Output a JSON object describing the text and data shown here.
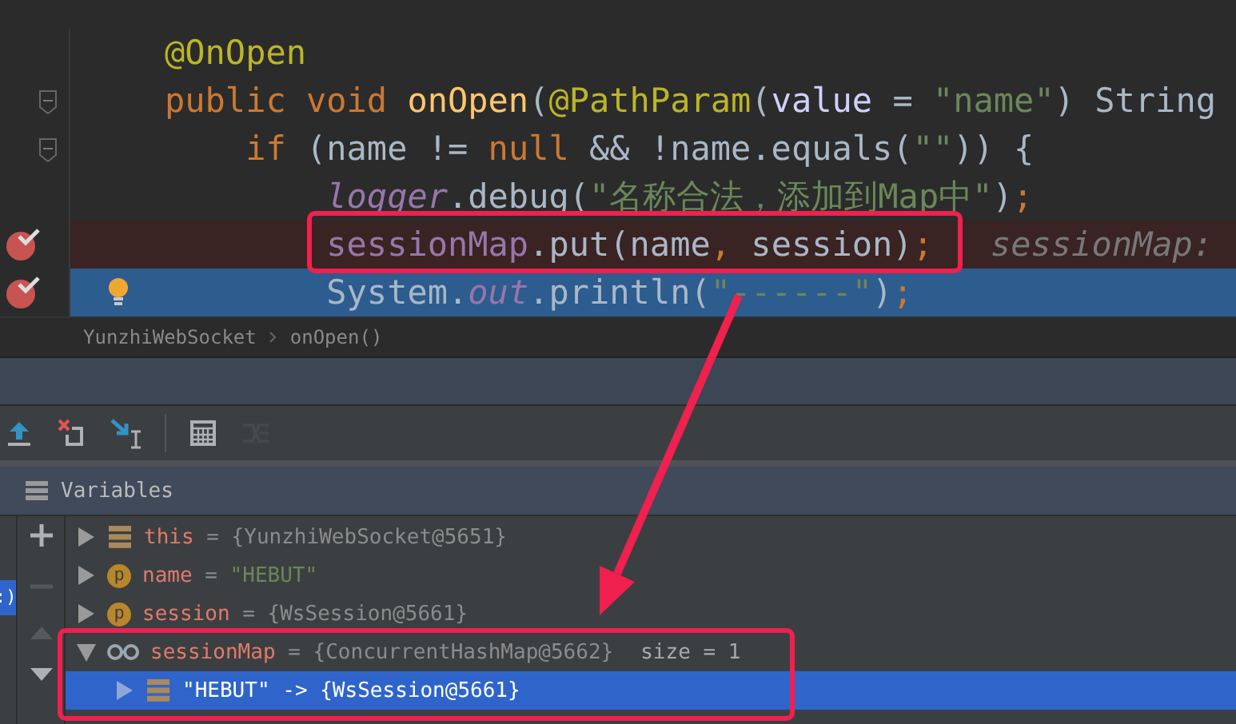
{
  "editor": {
    "lines": [
      {
        "breakpoint": false,
        "current": false,
        "fold": false,
        "hint": false,
        "tokens": [
          {
            "text": "@OnOpen",
            "kind": "annotation"
          }
        ]
      },
      {
        "breakpoint": false,
        "current": false,
        "fold": true,
        "hint": false,
        "tokens": [
          {
            "text": "public void ",
            "kind": "keyword"
          },
          {
            "text": "onOpen",
            "kind": "method"
          },
          {
            "text": "(",
            "kind": "plain"
          },
          {
            "text": "@PathParam",
            "kind": "annotation"
          },
          {
            "text": "(",
            "kind": "plain"
          },
          {
            "text": "value",
            "kind": "param"
          },
          {
            "text": " = ",
            "kind": "plain"
          },
          {
            "text": "\"name\"",
            "kind": "string"
          },
          {
            "text": ") String",
            "kind": "plain"
          }
        ],
        "children": [
          {
            "breakpoint": false,
            "current": false,
            "fold": true,
            "hint": false,
            "tokens": [
              {
                "text": "if ",
                "kind": "keyword"
              },
              {
                "text": "(name != ",
                "kind": "plain"
              },
              {
                "text": "null",
                "kind": "keyword"
              },
              {
                "text": " && !name.equals(",
                "kind": "plain"
              },
              {
                "text": "\"\"",
                "kind": "string"
              },
              {
                "text": ")) {",
                "kind": "plain"
              }
            ],
            "children": [
              {
                "breakpoint": false,
                "current": false,
                "fold": false,
                "hint": false,
                "tokens": [
                  {
                    "text": "logger",
                    "kind": "static"
                  },
                  {
                    "text": ".debug(",
                    "kind": "plain"
                  },
                  {
                    "text": "\"名称合法，添加到Map中\"",
                    "kind": "string"
                  },
                  {
                    "text": ")",
                    "kind": "plain"
                  },
                  {
                    "text": ";",
                    "kind": "punct"
                  }
                ]
              },
              {
                "breakpoint": true,
                "current": false,
                "fold": false,
                "hint": false,
                "tokens": [
                  {
                    "text": "sessionMap",
                    "kind": "field"
                  },
                  {
                    "text": ".put(name",
                    "kind": "plain"
                  },
                  {
                    "text": ",",
                    "kind": "punct"
                  },
                  {
                    "text": " session)",
                    "kind": "plain"
                  },
                  {
                    "text": ";",
                    "kind": "punct"
                  },
                  {
                    "text": "sessionMap:",
                    "kind": "inline-value"
                  }
                ]
              },
              {
                "breakpoint": true,
                "current": true,
                "fold": false,
                "hint": true,
                "tokens": [
                  {
                    "text": "System.",
                    "kind": "plain"
                  },
                  {
                    "text": "out",
                    "kind": "static"
                  },
                  {
                    "text": ".println(",
                    "kind": "plain"
                  },
                  {
                    "text": "\"------\"",
                    "kind": "string"
                  },
                  {
                    "text": ")",
                    "kind": "plain"
                  },
                  {
                    "text": ";",
                    "kind": "punct"
                  }
                ]
              }
            ]
          }
        ]
      }
    ]
  },
  "breadcrumbs": [
    "YunzhiWebSocket",
    "onOpen()"
  ],
  "toolbar": [
    {
      "kind": "step-out",
      "disabled": false
    },
    {
      "kind": "drop-frame",
      "disabled": false
    },
    {
      "kind": "run-to-cursor",
      "disabled": false
    },
    {
      "kind": "separator"
    },
    {
      "kind": "evaluate",
      "disabled": false
    },
    {
      "kind": "trace",
      "disabled": true
    }
  ],
  "left_edge_fragment": ":)",
  "variables": {
    "title": "Variables",
    "side_buttons": [
      {
        "kind": "add",
        "disabled": false
      },
      {
        "kind": "remove",
        "disabled": true
      },
      {
        "kind": "up",
        "disabled": true
      },
      {
        "kind": "down",
        "disabled": false
      }
    ],
    "rows": [
      {
        "kind": "field",
        "name": "this",
        "separator": "=",
        "value": "{YunzhiWebSocket@5651}",
        "string_value": false,
        "expanded": false,
        "selected": false
      },
      {
        "kind": "param",
        "badge": "p",
        "name": "name",
        "separator": "=",
        "value": "\"HEBUT\"",
        "string_value": true,
        "expanded": false,
        "selected": false
      },
      {
        "kind": "param",
        "badge": "p",
        "name": "session",
        "separator": "=",
        "value": "{WsSession@5661}",
        "string_value": false,
        "expanded": false,
        "selected": false
      },
      {
        "kind": "watch",
        "name": "sessionMap",
        "separator": "=",
        "value": "{ConcurrentHashMap@5662}",
        "string_value": false,
        "extra": "size = 1",
        "expanded": true,
        "selected": false,
        "children": [
          {
            "kind": "entry",
            "name": "\"HEBUT\"",
            "separator": "->",
            "value": "{WsSession@5661}",
            "string_value": false,
            "expanded": false,
            "selected": true
          }
        ]
      }
    ]
  }
}
